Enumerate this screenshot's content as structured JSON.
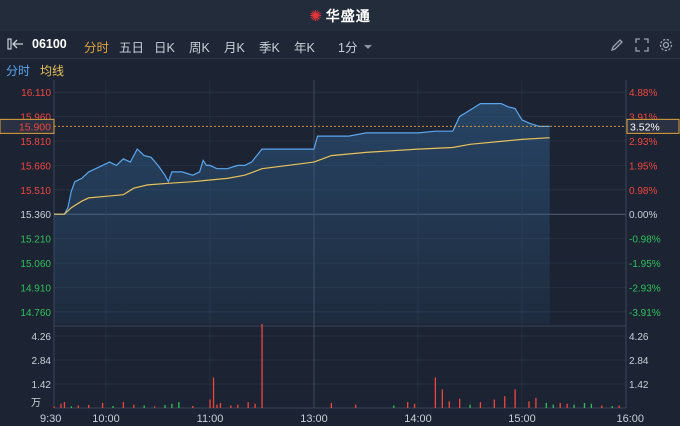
{
  "brand": {
    "logo": "✺",
    "name": "华盛通"
  },
  "toolbar": {
    "expand_icon": "panel-expand-icon",
    "code": "06100",
    "periods": [
      "分时",
      "五日",
      "日K",
      "周K",
      "月K",
      "季K",
      "年K"
    ],
    "active_period": "分时",
    "interval": "1分",
    "interval_icon": "chevron-down-icon",
    "tools": [
      "pencil-icon",
      "fullscreen-icon",
      "settings-icon"
    ]
  },
  "subbar": {
    "line1": "分时",
    "line2": "均线"
  },
  "colors": {
    "price_line": "#5aa6ee",
    "avg_line": "#e8c15a",
    "up": "#f0453d",
    "down": "#2fc05a",
    "neutral": "#c7cfda",
    "accent": "#e0a23a"
  },
  "chart_data": {
    "type": "line",
    "price_ticks": [
      "16.110",
      "15.960",
      "15.810",
      "15.660",
      "15.510",
      "15.360",
      "15.210",
      "15.060",
      "14.910",
      "14.760"
    ],
    "pct_ticks": [
      "4.88%",
      "3.91%",
      "2.93%",
      "1.95%",
      "0.98%",
      "0.00%",
      "-0.98%",
      "-1.95%",
      "-2.93%",
      "-3.91%"
    ],
    "base_price": 15.36,
    "ylim": [
      14.685,
      16.185
    ],
    "current_price": "15.900",
    "current_pct": "3.52%",
    "x_ticks": [
      "9:30",
      "10:00",
      "11:00",
      "13:00",
      "14:00",
      "15:00",
      "16:00"
    ],
    "volume_ticks": [
      "4.26",
      "2.84",
      "1.42"
    ],
    "volume_unit": "万",
    "volume_max": 4.97,
    "series": [
      {
        "values": [
          [
            "09:30",
            15.36
          ],
          [
            "09:36",
            15.36
          ],
          [
            "09:38",
            15.4
          ],
          [
            "09:40",
            15.5
          ],
          [
            "09:42",
            15.56
          ],
          [
            "09:46",
            15.58
          ],
          [
            "09:50",
            15.62
          ],
          [
            "09:54",
            15.64
          ],
          [
            "09:58",
            15.66
          ],
          [
            "10:02",
            15.68
          ],
          [
            "10:06",
            15.66
          ],
          [
            "10:10",
            15.7
          ],
          [
            "10:14",
            15.68
          ],
          [
            "10:18",
            15.76
          ],
          [
            "10:22",
            15.72
          ],
          [
            "10:26",
            15.71
          ],
          [
            "10:30",
            15.66
          ],
          [
            "10:34",
            15.6
          ],
          [
            "10:36",
            15.56
          ],
          [
            "10:38",
            15.62
          ],
          [
            "10:44",
            15.62
          ],
          [
            "10:50",
            15.6
          ],
          [
            "10:54",
            15.62
          ],
          [
            "10:56",
            15.69
          ],
          [
            "10:58",
            15.66
          ],
          [
            "11:00",
            15.66
          ],
          [
            "11:04",
            15.64
          ],
          [
            "11:10",
            15.64
          ],
          [
            "11:16",
            15.66
          ],
          [
            "11:20",
            15.66
          ],
          [
            "11:24",
            15.68
          ],
          [
            "11:30",
            15.76
          ],
          [
            "13:00",
            15.76
          ],
          [
            "13:02",
            15.84
          ],
          [
            "13:10",
            15.84
          ],
          [
            "13:20",
            15.84
          ],
          [
            "13:30",
            15.86
          ],
          [
            "13:40",
            15.86
          ],
          [
            "14:00",
            15.86
          ],
          [
            "14:10",
            15.87
          ],
          [
            "14:20",
            15.87
          ],
          [
            "14:24",
            15.96
          ],
          [
            "14:30",
            16.0
          ],
          [
            "14:36",
            16.04
          ],
          [
            "14:42",
            16.04
          ],
          [
            "14:48",
            16.04
          ],
          [
            "14:52",
            16.02
          ],
          [
            "14:56",
            16.01
          ],
          [
            "15:00",
            15.94
          ],
          [
            "15:04",
            15.92
          ],
          [
            "15:10",
            15.9
          ],
          [
            "15:16",
            15.9
          ]
        ]
      },
      {
        "values": [
          [
            "09:30",
            15.36
          ],
          [
            "09:36",
            15.36
          ],
          [
            "09:40",
            15.4
          ],
          [
            "09:46",
            15.44
          ],
          [
            "09:50",
            15.46
          ],
          [
            "10:00",
            15.47
          ],
          [
            "10:10",
            15.48
          ],
          [
            "10:16",
            15.52
          ],
          [
            "10:24",
            15.54
          ],
          [
            "10:36",
            15.55
          ],
          [
            "10:50",
            15.56
          ],
          [
            "11:00",
            15.57
          ],
          [
            "11:10",
            15.58
          ],
          [
            "11:20",
            15.6
          ],
          [
            "11:30",
            15.64
          ],
          [
            "13:00",
            15.68
          ],
          [
            "13:10",
            15.72
          ],
          [
            "13:30",
            15.74
          ],
          [
            "14:00",
            15.76
          ],
          [
            "14:20",
            15.77
          ],
          [
            "14:30",
            15.79
          ],
          [
            "14:50",
            15.81
          ],
          [
            "15:00",
            15.82
          ],
          [
            "15:16",
            15.83
          ]
        ]
      }
    ],
    "volume": [
      [
        "09:30",
        0.1,
        "up"
      ],
      [
        "09:34",
        0.25,
        "up"
      ],
      [
        "09:36",
        0.35,
        "up"
      ],
      [
        "09:40",
        0.1,
        "down"
      ],
      [
        "09:44",
        0.15,
        "up"
      ],
      [
        "09:50",
        0.18,
        "up"
      ],
      [
        "09:58",
        0.3,
        "up"
      ],
      [
        "10:04",
        0.12,
        "down"
      ],
      [
        "10:10",
        0.35,
        "up"
      ],
      [
        "10:16",
        0.2,
        "up"
      ],
      [
        "10:22",
        0.15,
        "down"
      ],
      [
        "10:28",
        0.1,
        "up"
      ],
      [
        "10:34",
        0.18,
        "down"
      ],
      [
        "10:38",
        0.25,
        "down"
      ],
      [
        "10:42",
        0.35,
        "down"
      ],
      [
        "10:50",
        0.12,
        "up"
      ],
      [
        "11:00",
        0.5,
        "up"
      ],
      [
        "11:02",
        1.8,
        "up"
      ],
      [
        "11:04",
        0.2,
        "up"
      ],
      [
        "11:06",
        0.3,
        "up"
      ],
      [
        "11:12",
        0.15,
        "up"
      ],
      [
        "11:16",
        0.2,
        "up"
      ],
      [
        "11:22",
        0.35,
        "up"
      ],
      [
        "11:26",
        0.25,
        "up"
      ],
      [
        "11:30",
        4.97,
        "up"
      ],
      [
        "13:10",
        0.3,
        "up"
      ],
      [
        "13:24",
        0.2,
        "up"
      ],
      [
        "13:46",
        0.15,
        "down"
      ],
      [
        "13:54",
        0.35,
        "up"
      ],
      [
        "13:58",
        0.25,
        "up"
      ],
      [
        "14:10",
        1.8,
        "up"
      ],
      [
        "14:14",
        1.1,
        "up"
      ],
      [
        "14:18",
        0.4,
        "up"
      ],
      [
        "14:24",
        0.55,
        "up"
      ],
      [
        "14:30",
        0.2,
        "down"
      ],
      [
        "14:36",
        0.35,
        "up"
      ],
      [
        "14:44",
        0.5,
        "up"
      ],
      [
        "14:50",
        0.7,
        "up"
      ],
      [
        "14:56",
        1.1,
        "up"
      ],
      [
        "15:04",
        0.4,
        "up"
      ],
      [
        "15:08",
        0.6,
        "up"
      ],
      [
        "15:14",
        0.3,
        "down"
      ],
      [
        "15:18",
        0.2,
        "down"
      ],
      [
        "15:22",
        0.3,
        "up"
      ],
      [
        "15:26",
        0.25,
        "up"
      ],
      [
        "15:30",
        0.2,
        "down"
      ],
      [
        "15:36",
        0.3,
        "down"
      ],
      [
        "15:40",
        0.25,
        "down"
      ],
      [
        "15:46",
        0.15,
        "up"
      ],
      [
        "15:52",
        0.12,
        "down"
      ],
      [
        "15:56",
        0.15,
        "up"
      ]
    ]
  }
}
